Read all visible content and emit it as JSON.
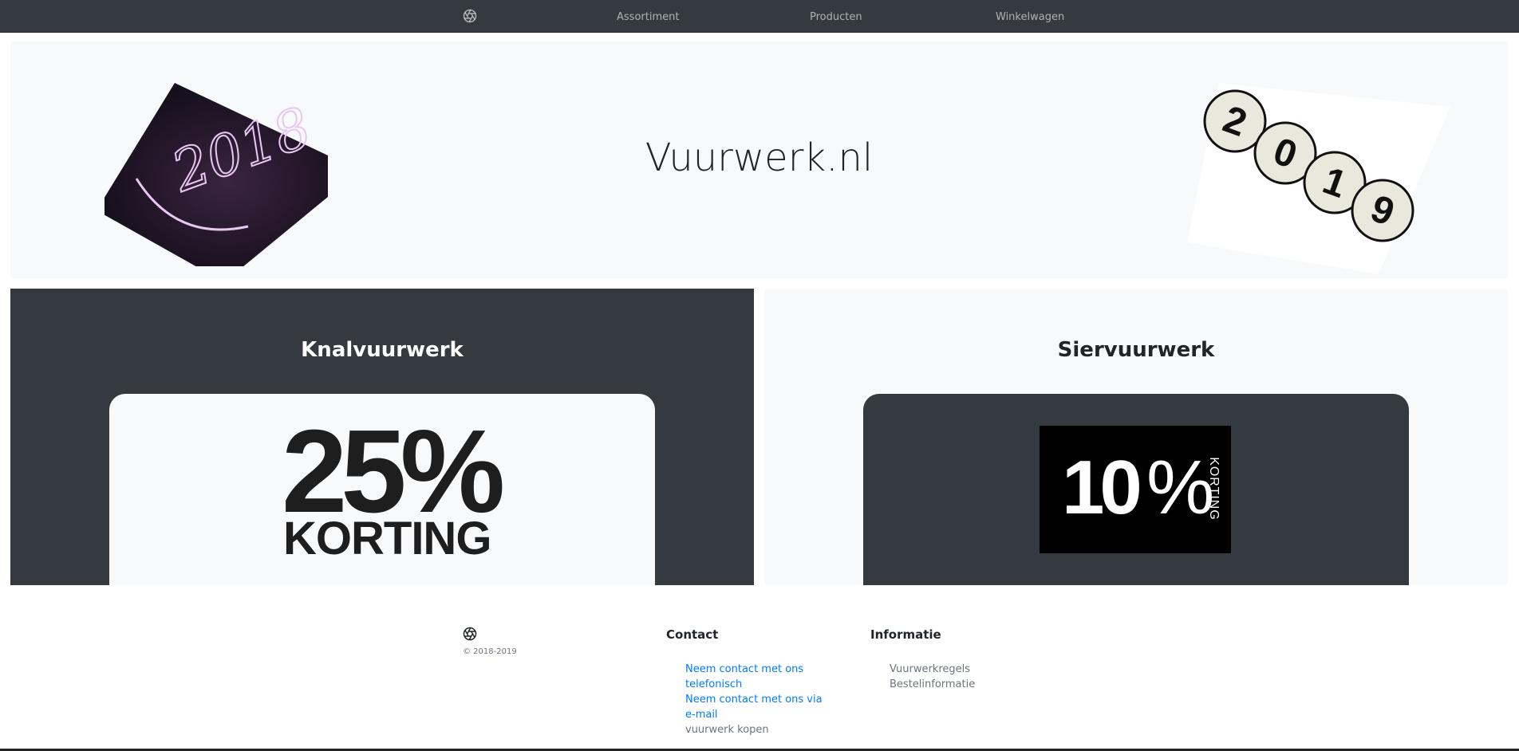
{
  "nav": {
    "logo_icon": "aperture-icon",
    "items": [
      {
        "label": "Assortiment"
      },
      {
        "label": "Producten"
      },
      {
        "label": "Winkelwagen"
      }
    ]
  },
  "hero": {
    "title": "Vuurwerk.nl",
    "left_image_text": "2018",
    "right_image_digits": [
      "2",
      "0",
      "1",
      "9"
    ]
  },
  "panels": [
    {
      "title": "Knalvuurwerk",
      "promo_number": "25%",
      "promo_text": "KORTING"
    },
    {
      "title": "Siervuurwerk",
      "promo_number": "10",
      "promo_percent": "%",
      "promo_text": "KORTING"
    }
  ],
  "footer": {
    "copyright": "© 2018-2019",
    "contact": {
      "heading": "Contact",
      "links": [
        {
          "label": "Neem contact met ons telefonisch"
        },
        {
          "label": "Neem contact met ons via e-mail"
        },
        {
          "label": "vuurwerk kopen"
        }
      ]
    },
    "info": {
      "heading": "Informatie",
      "links": [
        {
          "label": "Vuurwerkregels"
        },
        {
          "label": "Bestelinformatie"
        }
      ]
    }
  },
  "colors": {
    "navbar": "#343a40",
    "light": "#f8f9fa",
    "link_blue": "#007bff",
    "muted": "#6c757d"
  }
}
